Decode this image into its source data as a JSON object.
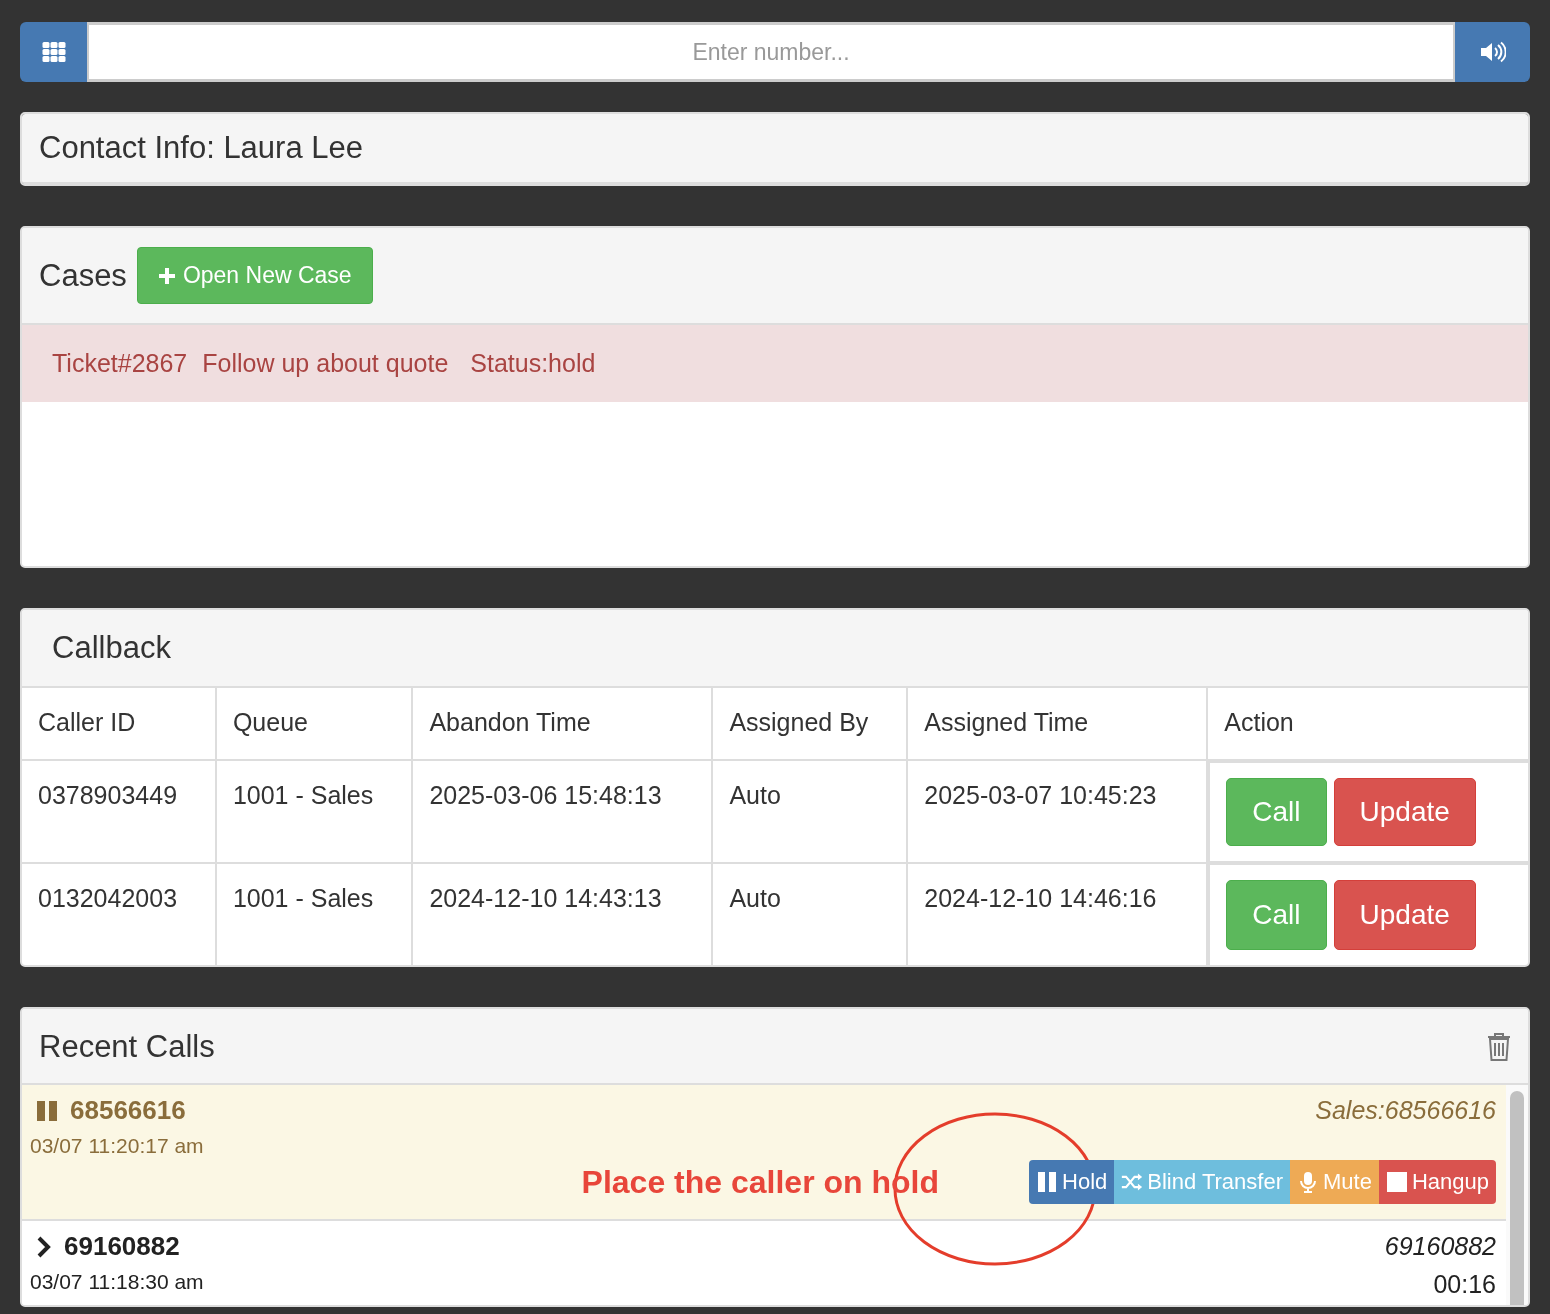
{
  "dialer": {
    "placeholder": "Enter number..."
  },
  "contact": {
    "title": "Contact Info: Laura Lee"
  },
  "cases": {
    "title": "Cases",
    "new_button": "Open New Case",
    "items": [
      {
        "ticket": "Ticket#2867",
        "subject": "Follow up about quote",
        "status": "Status:hold"
      }
    ]
  },
  "callback": {
    "title": "Callback",
    "columns": [
      "Caller ID",
      "Queue",
      "Abandon Time",
      "Assigned By",
      "Assigned Time",
      "Action"
    ],
    "rows": [
      {
        "cells": [
          "0378903449",
          "1001 - Sales",
          "2025-03-06 15:48:13",
          "Auto",
          "2025-03-07 10:45:23"
        ],
        "actions": [
          "Call",
          "Update"
        ]
      },
      {
        "cells": [
          "0132042003",
          "1001 - Sales",
          "2024-12-10 14:43:13",
          "Auto",
          "2024-12-10 14:46:16"
        ],
        "actions": [
          "Call",
          "Update"
        ]
      }
    ]
  },
  "recent_calls": {
    "title": "Recent Calls",
    "calls": [
      {
        "kind": "active",
        "number": "68566616",
        "time": "03/07 11:20:17 am",
        "info": "Sales:68566616",
        "annotation": "Place the caller on hold",
        "buttons": [
          {
            "kind": "hold",
            "label": "Hold"
          },
          {
            "kind": "transfer",
            "label": "Blind Transfer"
          },
          {
            "kind": "mute",
            "label": "Mute"
          },
          {
            "kind": "hangup",
            "label": "Hangup"
          }
        ]
      },
      {
        "kind": "ended",
        "number": "69160882",
        "time": "03/07 11:18:30 am",
        "info": "69160882",
        "duration": "00:16"
      }
    ]
  }
}
